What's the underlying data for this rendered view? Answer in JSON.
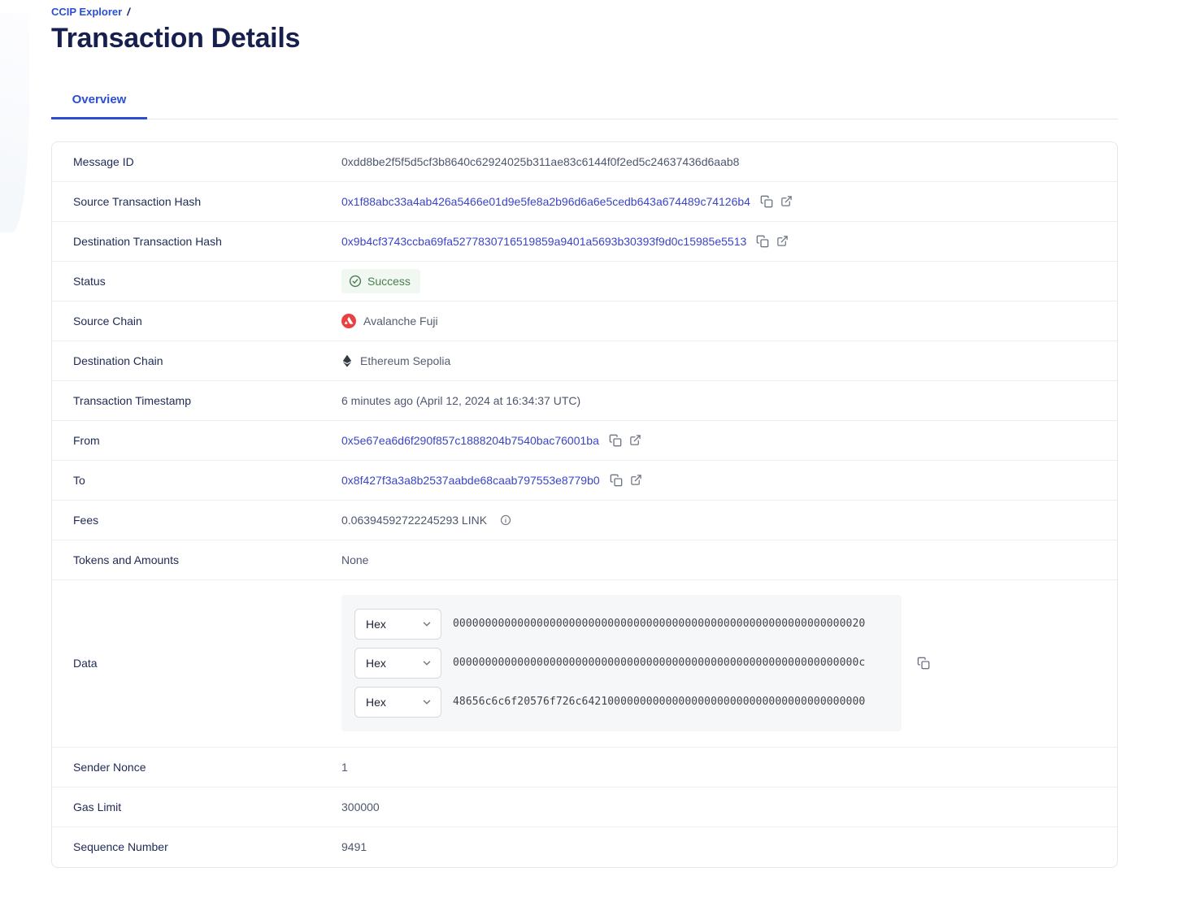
{
  "breadcrumb": {
    "link": "CCIP Explorer",
    "separator": "/"
  },
  "page_title": "Transaction Details",
  "tabs": [
    {
      "label": "Overview"
    }
  ],
  "fields": {
    "message_id": {
      "label": "Message ID",
      "value": "0xdd8be2f5f5d5cf3b8640c62924025b311ae83c6144f0f2ed5c24637436d6aab8"
    },
    "source_tx_hash": {
      "label": "Source Transaction Hash",
      "value": "0x1f88abc33a4ab426a5466e01d9e5fe8a2b96d6a6e5cedb643a674489c74126b4"
    },
    "destination_tx_hash": {
      "label": "Destination Transaction Hash",
      "value": "0x9b4cf3743ccba69fa5277830716519859a9401a5693b30393f9d0c15985e5513"
    },
    "status": {
      "label": "Status",
      "value": "Success"
    },
    "source_chain": {
      "label": "Source Chain",
      "value": "Avalanche Fuji",
      "icon": "avalanche-icon"
    },
    "destination_chain": {
      "label": "Destination Chain",
      "value": "Ethereum Sepolia",
      "icon": "ethereum-icon"
    },
    "transaction_timestamp": {
      "label": "Transaction Timestamp",
      "value": "6 minutes ago (April 12, 2024 at 16:34:37 UTC)"
    },
    "from": {
      "label": "From",
      "value": "0x5e67ea6d6f290f857c1888204b7540bac76001ba"
    },
    "to": {
      "label": "To",
      "value": "0x8f427f3a3a8b2537aabde68caab797553e8779b0"
    },
    "fees": {
      "label": "Fees",
      "value": "0.06394592722245293 LINK"
    },
    "tokens_and_amounts": {
      "label": "Tokens and Amounts",
      "value": "None"
    },
    "data": {
      "label": "Data",
      "encoding": "Hex",
      "lines": [
        "0000000000000000000000000000000000000000000000000000000000000020",
        "000000000000000000000000000000000000000000000000000000000000000c",
        "48656c6c6f20576f726c64210000000000000000000000000000000000000000"
      ]
    },
    "sender_nonce": {
      "label": "Sender Nonce",
      "value": "1"
    },
    "gas_limit": {
      "label": "Gas Limit",
      "value": "300000"
    },
    "sequence_number": {
      "label": "Sequence Number",
      "value": "9491"
    }
  },
  "colors": {
    "accent_blue": "#2b4fd3",
    "link_indigo": "#3a45c5",
    "title_navy": "#171f4e",
    "success_green": "#4a7e51",
    "success_bg": "#f1f8f1",
    "avalanche_red": "#e84142",
    "hex_box_bg": "#f6f7f9"
  }
}
